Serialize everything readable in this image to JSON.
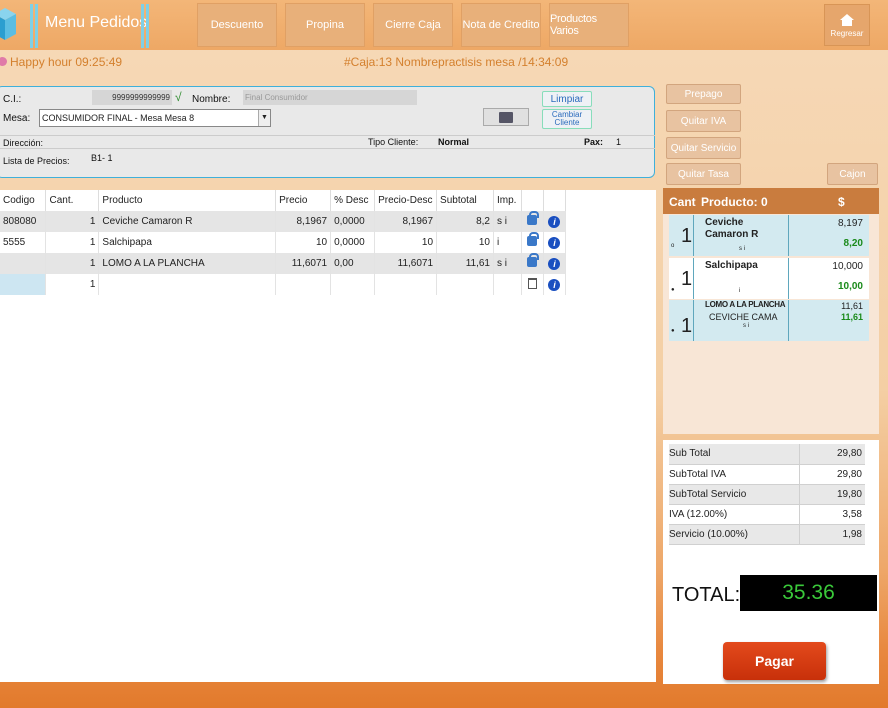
{
  "header": {
    "title": "Menu Pedidos",
    "buttons": [
      "Descuento",
      "Propina",
      "Cierre Caja",
      "Nota de Credito",
      "Productos Varios"
    ],
    "home_label": "Regresar"
  },
  "status": {
    "happy_hour": "Happy hour  09:25:49",
    "caja": "#Caja:13  Nombrepractisis mesa  /14:34:09"
  },
  "client": {
    "ci_label": "C.I.:",
    "ci_value": "9999999999999",
    "check": "√",
    "nombre_label": "Nombre:",
    "nombre_value": "Final Consumidor",
    "mesa_label": "Mesa:",
    "mesa_value": "CONSUMIDOR FINAL - Mesa Mesa 8",
    "direccion_label": "Dirección:",
    "tipo_label": "Tipo Cliente:",
    "tipo_value": "Normal",
    "pax_label": "Pax:",
    "pax_value": "1",
    "lista_label": "Lista de Precios:",
    "lista_value": "B1-   1",
    "limpiar": "Limpiar",
    "cambiar": "Cambiar Cliente"
  },
  "side_buttons": {
    "prepago": "Prepago",
    "quitar_iva": "Quitar IVA",
    "quitar_servicio": "Quitar Servicio",
    "quitar_tasa": "Quitar Tasa",
    "cajon": "Cajon"
  },
  "items_table": {
    "headers": [
      "Codigo",
      "Cant.",
      "Producto",
      "Precio",
      "% Desc",
      "Precio-Desc",
      "Subtotal",
      "Imp."
    ],
    "rows": [
      {
        "codigo": "808080",
        "cant": "1",
        "producto": "Ceviche Camaron R",
        "precio": "8,1967",
        "desc": "0,0000",
        "precio_desc": "8,1967",
        "subtotal": "8,2",
        "imp": "s i"
      },
      {
        "codigo": "5555",
        "cant": "1",
        "producto": "Salchipapa",
        "precio": "10",
        "desc": "0,0000",
        "precio_desc": "10",
        "subtotal": "10",
        "imp": "i"
      },
      {
        "codigo": "",
        "cant": "1",
        "producto": "LOMO A LA PLANCHA",
        "precio": "11,6071",
        "desc": "0,00",
        "precio_desc": "11,6071",
        "subtotal": "11,61",
        "imp": "s i"
      },
      {
        "codigo": "",
        "cant": "1",
        "producto": "",
        "precio": "",
        "desc": "",
        "precio_desc": "",
        "subtotal": "",
        "imp": ""
      }
    ]
  },
  "order": {
    "header_cant": "Cant",
    "header_producto": "Producto:  0",
    "header_price": "$",
    "items": [
      {
        "qty": "1",
        "name": "Ceviche Camaron R",
        "tag": "s i",
        "price": "8,197",
        "total": "8,20"
      },
      {
        "qty": "1",
        "name": "Salchipapa",
        "tag": "i",
        "price": "10,000",
        "total": "10,00"
      },
      {
        "qty": "1",
        "name": "LOMO A LA PLANCHA",
        "sub": "CEVICHE CAMA",
        "tag": "s i",
        "price": "11,61",
        "total": "11,61"
      }
    ]
  },
  "totals": {
    "rows": [
      {
        "label": "Sub Total",
        "value": "29,80"
      },
      {
        "label": "SubTotal IVA",
        "value": "29,80"
      },
      {
        "label": "SubTotal Servicio",
        "value": "19,80"
      },
      {
        "label": "IVA (12.00%)",
        "value": "3,58"
      },
      {
        "label": "Servicio (10.00%)",
        "value": "1,98"
      }
    ],
    "total_label": "TOTAL:",
    "total_value": "35.36",
    "pay_label": "Pagar"
  }
}
